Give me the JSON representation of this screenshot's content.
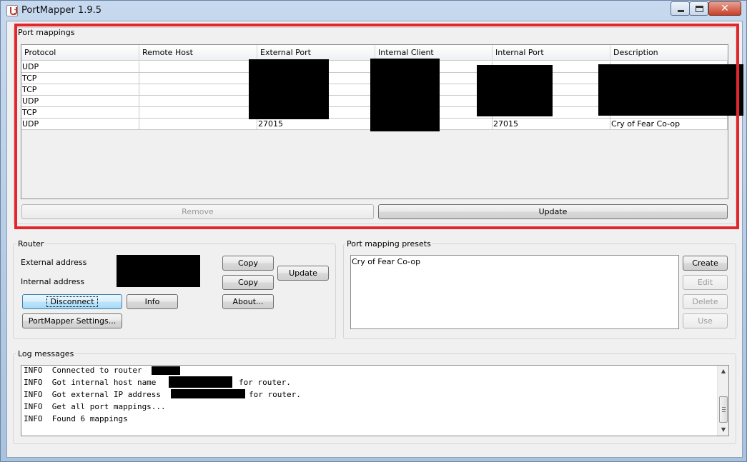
{
  "window": {
    "title": "PortMapper 1.9.5"
  },
  "port_mappings": {
    "group_title": "Port mappings",
    "columns": [
      "Protocol",
      "Remote Host",
      "External Port",
      "Internal Client",
      "Internal Port",
      "Description"
    ],
    "rows": [
      {
        "protocol": "UDP",
        "remote_host": "",
        "external_port": "",
        "internal_client": "",
        "internal_port": "",
        "description": ""
      },
      {
        "protocol": "TCP",
        "remote_host": "",
        "external_port": "",
        "internal_client": "",
        "internal_port": "",
        "description": ""
      },
      {
        "protocol": "TCP",
        "remote_host": "",
        "external_port": "",
        "internal_client": "",
        "internal_port": "",
        "description": ""
      },
      {
        "protocol": "UDP",
        "remote_host": "",
        "external_port": "",
        "internal_client": "",
        "internal_port": "",
        "description": ""
      },
      {
        "protocol": "TCP",
        "remote_host": "",
        "external_port": "",
        "internal_client": "",
        "internal_port": "",
        "description": ""
      },
      {
        "protocol": "UDP",
        "remote_host": "",
        "external_port": "27015",
        "internal_client": "",
        "internal_port": "27015",
        "description": "Cry of Fear Co-op"
      }
    ],
    "remove_label": "Remove",
    "update_label": "Update"
  },
  "router": {
    "group_title": "Router",
    "external_address_label": "External address",
    "internal_address_label": "Internal address",
    "copy_label": "Copy",
    "update_label": "Update",
    "disconnect_label": "Disconnect",
    "info_label": "Info",
    "about_label": "About...",
    "settings_label": "PortMapper Settings..."
  },
  "presets": {
    "group_title": "Port mapping presets",
    "items": [
      "Cry of Fear Co-op"
    ],
    "create_label": "Create",
    "edit_label": "Edit",
    "delete_label": "Delete",
    "use_label": "Use"
  },
  "log": {
    "group_title": "Log messages",
    "lines": [
      "INFO  Connected to router",
      "INFO  Got internal host name",
      "INFO  Got external IP address",
      "INFO  Get all port mappings...",
      "INFO  Found 6 mappings"
    ],
    "line_suffixes": [
      "",
      "for router.",
      "for router.",
      "",
      ""
    ]
  },
  "colors": {
    "highlight": "#e3262b",
    "redaction": "#000000"
  }
}
